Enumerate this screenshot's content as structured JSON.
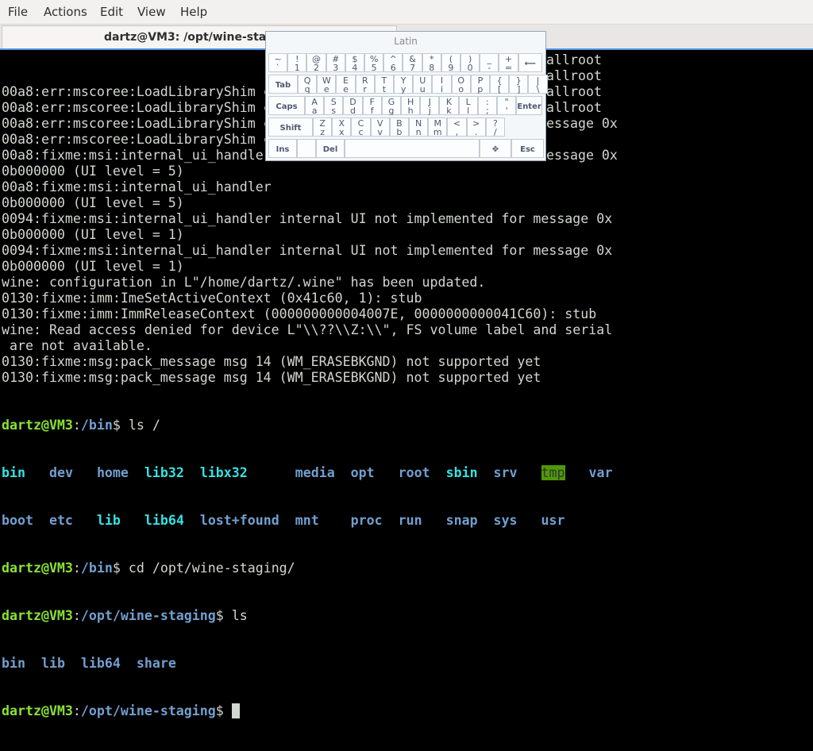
{
  "menu": [
    "File",
    "Actions",
    "Edit",
    "View",
    "Help"
  ],
  "tab": {
    "title": "dartz@VM3: /opt/wine-staging"
  },
  "terminal": {
    "log": [
      "00a8:err:mscoree:LoadLibraryShim c",
      "00a8:err:mscoree:LoadLibraryShim c",
      "00a8:err:mscoree:LoadLibraryShim c",
      "00a8:err:mscoree:LoadLibraryShim c",
      "00a8:fixme:msi:internal_ui_handler",
      "0b000000 (UI level = 5)",
      "00a8:fixme:msi:internal_ui_handler",
      "0b000000 (UI level = 5)",
      "0094:fixme:msi:internal_ui_handler internal UI not implemented for message 0x",
      "0b000000 (UI level = 1)",
      "0094:fixme:msi:internal_ui_handler internal UI not implemented for message 0x",
      "0b000000 (UI level = 1)",
      "wine: configuration in L\"/home/dartz/.wine\" has been updated.",
      "0130:fixme:imm:ImeSetActiveContext (0x41c60, 1): stub",
      "0130:fixme:imm:ImmReleaseContext (000000000004007E, 0000000000041C60): stub",
      "wine: Read access denied for device L\"\\\\??\\\\Z:\\\\\", FS volume label and serial",
      " are not available.",
      "0130:fixme:msg:pack_message msg 14 (WM_ERASEBKGND) not supported yet",
      "0130:fixme:msg:pack_message msg 14 (WM_ERASEBKGND) not supported yet"
    ],
    "overflow_right": [
      {
        "row": 0,
        "text": "allroot"
      },
      {
        "row": 1,
        "text": "allroot"
      },
      {
        "row": 2,
        "text": "allroot"
      },
      {
        "row": 3,
        "text": "allroot"
      },
      {
        "row": 4,
        "text": "essage 0x"
      },
      {
        "row": 6,
        "text": "essage 0x"
      }
    ],
    "prompt_user": "dartz@VM3",
    "prompt_sep": ":",
    "p1_path": "/bin",
    "p1_cmd": "$ ls /",
    "ls_root": [
      [
        "bin",
        "dev",
        "home",
        "lib32",
        "libx32",
        "media",
        "opt",
        "root",
        "sbin",
        "srv",
        "tmp",
        "var"
      ],
      [
        "boot",
        "etc",
        "lib",
        "lib64",
        "lost+found",
        "mnt",
        "proc",
        "run",
        "snap",
        "sys",
        "usr"
      ]
    ],
    "p2_path": "/bin",
    "p2_cmd": "$ cd /opt/wine-staging/",
    "p3_path": "/opt/wine-staging",
    "p3_cmd": "$ ls",
    "ls_opt": [
      "bin",
      "lib",
      "lib64",
      "share"
    ],
    "p4_path": "/opt/wine-staging",
    "p4_cmd": "$ "
  },
  "keyboard": {
    "title": "Latin",
    "row1": [
      [
        "~",
        "`"
      ],
      [
        "!",
        "1"
      ],
      [
        "@",
        "2"
      ],
      [
        "#",
        "3"
      ],
      [
        "$",
        "4"
      ],
      [
        "%",
        "5"
      ],
      [
        "^",
        "6"
      ],
      [
        "&",
        "7"
      ],
      [
        "*",
        "8"
      ],
      [
        "(",
        "9"
      ],
      [
        ")",
        "0"
      ],
      [
        "_",
        "-"
      ],
      [
        "+",
        "="
      ]
    ],
    "backspace": "⟵",
    "tab": "Tab",
    "row2": [
      [
        "Q",
        "q"
      ],
      [
        "W",
        "e"
      ],
      [
        "E",
        "e"
      ],
      [
        "R",
        "r"
      ],
      [
        "T",
        "t"
      ],
      [
        "Y",
        "y"
      ],
      [
        "U",
        "u"
      ],
      [
        "I",
        "i"
      ],
      [
        "O",
        "o"
      ],
      [
        "P",
        "p"
      ],
      [
        "{",
        "["
      ],
      [
        "}",
        "]"
      ],
      [
        "|",
        "\\"
      ]
    ],
    "caps": "Caps",
    "row3": [
      [
        "A",
        "a"
      ],
      [
        "S",
        "s"
      ],
      [
        "D",
        "d"
      ],
      [
        "F",
        "f"
      ],
      [
        "G",
        "g"
      ],
      [
        "H",
        "h"
      ],
      [
        "J",
        "j"
      ],
      [
        "K",
        "k"
      ],
      [
        "L",
        "l"
      ],
      [
        ":",
        ";"
      ],
      [
        "\"",
        "'"
      ]
    ],
    "enter": "Enter",
    "shift": "Shift",
    "row4": [
      [
        "Z",
        "z"
      ],
      [
        "X",
        "x"
      ],
      [
        "C",
        "c"
      ],
      [
        "V",
        "v"
      ],
      [
        "B",
        "b"
      ],
      [
        "N",
        "n"
      ],
      [
        "M",
        "m"
      ],
      [
        "<",
        ","
      ],
      [
        ">",
        "."
      ],
      [
        "?",
        "/"
      ]
    ],
    "ins": "Ins",
    "del": "Del",
    "move": "✥",
    "esc": "Esc"
  }
}
